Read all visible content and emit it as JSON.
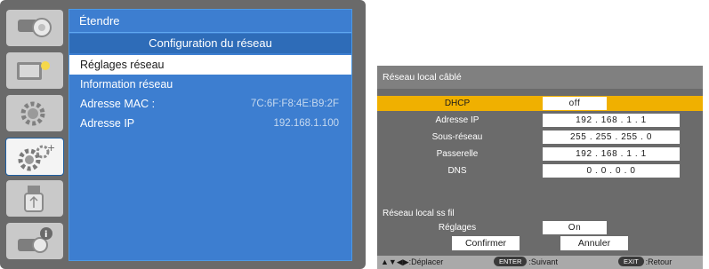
{
  "menu": {
    "side_tabs": [
      {
        "icon": "projector-image-icon"
      },
      {
        "icon": "display-adjust-icon"
      },
      {
        "icon": "gear-settings-icon"
      },
      {
        "icon": "advanced-gears-icon",
        "active": true
      },
      {
        "icon": "usb-icon"
      },
      {
        "icon": "info-icon"
      }
    ],
    "breadcrumb": "Étendre",
    "title": "Configuration du réseau",
    "rows": [
      {
        "label": "Réglages réseau",
        "value": "",
        "selected": true
      },
      {
        "label": "Information réseau",
        "value": "",
        "selected": false
      },
      {
        "label": "Adresse MAC :",
        "value": "7C:6F:F8:4E:B9:2F",
        "selected": false
      },
      {
        "label": "Adresse IP",
        "value": "192.168.1.100",
        "selected": false
      }
    ]
  },
  "lan_dialog": {
    "header": "Réseau local câblé",
    "rows": [
      {
        "label": "DHCP",
        "value": "off"
      },
      {
        "label": "Adresse IP",
        "value": "192 . 168 .   1 . 1"
      },
      {
        "label": "Sous-réseau",
        "value": "255 . 255 . 255 . 0"
      },
      {
        "label": "Passerelle",
        "value": "192 . 168 .   1 . 1"
      },
      {
        "label": "DNS",
        "value": "0   .   0   .   0 . 0"
      }
    ],
    "wireless": {
      "heading": "Réseau local ss fil",
      "setting_label": "Réglages",
      "setting_value": "On"
    },
    "buttons": {
      "confirm": "Confirmer",
      "cancel": "Annuler"
    },
    "footer": {
      "move_label": ":Déplacer",
      "enter_key": "ENTER",
      "enter_label": ":Suivant",
      "exit_key": "EXIT",
      "exit_label": ":Retour"
    }
  },
  "colors": {
    "menu_bg": "#6a6a6a",
    "menu_panel": "#3d7ed0",
    "highlight": "#f0b000",
    "dialog_bg": "#6b6b6b"
  }
}
